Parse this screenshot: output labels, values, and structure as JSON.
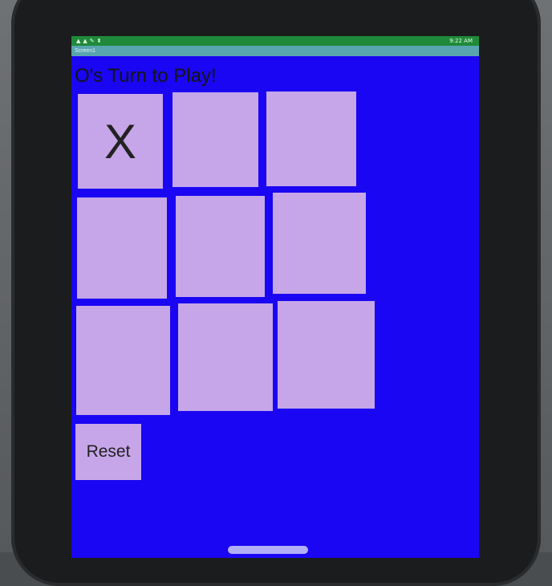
{
  "status_bar": {
    "left_icons": "▲▲✎⬍",
    "time": "9:22 AM"
  },
  "title_bar": {
    "title": "Screen1"
  },
  "game": {
    "turn_label": "O's Turn to Play!",
    "board": [
      "X",
      "",
      "",
      "",
      "",
      "",
      "",
      "",
      ""
    ],
    "reset_label": "Reset"
  },
  "colors": {
    "background": "#1a06f2",
    "cell": "#c6a6e8",
    "status_bar": "#1f8a3a",
    "title_bar": "#58a5b0"
  }
}
